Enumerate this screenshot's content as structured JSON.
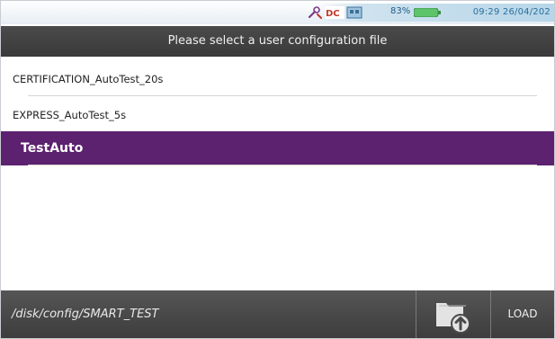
{
  "status": {
    "battery": "83%",
    "clock": "09:29  26/04/202",
    "icons": [
      "tools-icon",
      "dc-power-icon",
      "network-icon",
      "battery-icon"
    ]
  },
  "dialog": {
    "title": "Please select a user configuration file"
  },
  "files": [
    {
      "name": "CERTIFICATION_AutoTest_20s",
      "selected": false
    },
    {
      "name": "EXPRESS_AutoTest_5s",
      "selected": false
    },
    {
      "name": "TestAuto",
      "selected": true
    }
  ],
  "footer": {
    "path": "/disk/config/SMART_TEST",
    "upload_icon": "folder-upload-icon",
    "load_label": "LOAD"
  },
  "colors": {
    "selection": "#5c216f",
    "titlebar": "#3f3f3f",
    "footer": "#4a4a4a"
  }
}
